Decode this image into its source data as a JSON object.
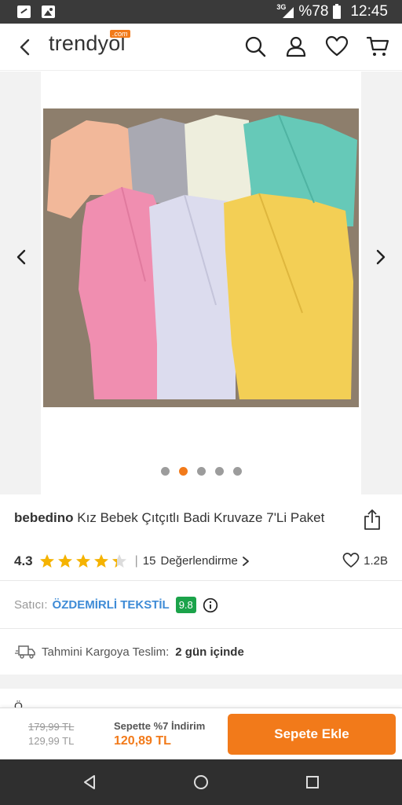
{
  "status_bar": {
    "network": "3G",
    "battery": "%78",
    "time": "12:45"
  },
  "header": {
    "logo": "trendyol",
    "logo_suffix": ".com"
  },
  "gallery": {
    "image_count": 5,
    "active_index": 1
  },
  "product": {
    "brand": "bebedino",
    "title": "Kız Bebek Çıtçıtlı Badi Kruvaze 7'Li Paket",
    "rating": "4.3",
    "rating_value": 4.3,
    "review_count": "15",
    "review_label": "Değerlendirme",
    "favorites": "1.2B"
  },
  "seller": {
    "label": "Satıcı:",
    "name": "ÖZDEMİRLİ TEKSTİL",
    "score": "9.8",
    "score_color": "#1ba34a"
  },
  "shipping": {
    "label": "Tahmini Kargoya Teslim:",
    "value": "2 gün içinde"
  },
  "next_section_peek": "Ö",
  "bottom_bar": {
    "old_price": "179,99 TL",
    "price": "129,99 TL",
    "basket_discount": "Sepette %7 İndirim",
    "basket_price": "120,89 TL",
    "add_to_cart": "Sepete Ekle"
  },
  "colors": {
    "accent": "#f27a1a",
    "seller_link": "#3e8bd6",
    "star": "#f5b301"
  }
}
